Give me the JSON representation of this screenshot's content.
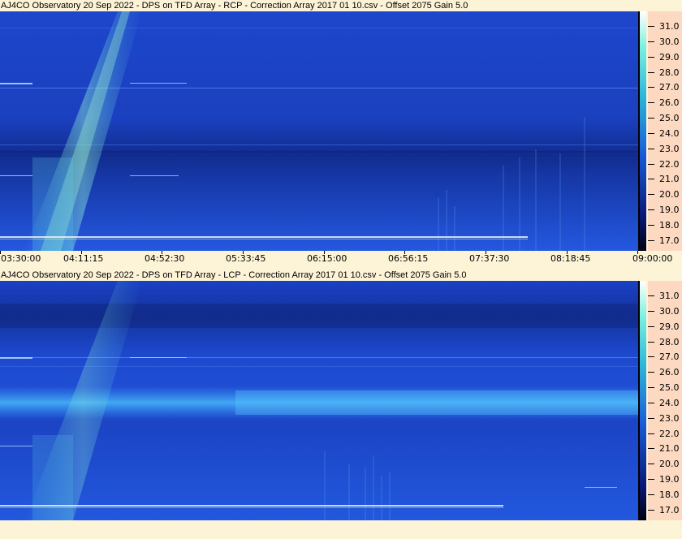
{
  "panels": [
    {
      "title": "AJ4CO Observatory 20 Sep 2022  -  DPS on TFD Array  -  RCP  -  Correction Array 2017 01 10.csv  -  Offset 2075  Gain 5.0",
      "freq_labels": [
        "31.0",
        "30.0",
        "29.0",
        "28.0",
        "27.0",
        "26.0",
        "25.0",
        "24.0",
        "23.0",
        "22.0",
        "21.0",
        "20.0",
        "19.0",
        "18.0",
        "17.0"
      ]
    },
    {
      "title": "AJ4CO Observatory 20 Sep 2022  -  DPS on TFD Array  -  LCP  -  Correction Array 2017 01 10.csv  -  Offset 2075  Gain 5.0",
      "freq_labels": [
        "31.0",
        "30.0",
        "29.0",
        "28.0",
        "27.0",
        "26.0",
        "25.0",
        "24.0",
        "23.0",
        "22.0",
        "21.0",
        "20.0",
        "19.0",
        "18.0",
        "17.0"
      ]
    }
  ],
  "time_labels": [
    "03:30:00",
    "04:11:15",
    "04:52:30",
    "05:33:45",
    "06:15:00",
    "06:56:15",
    "07:37:30",
    "08:18:45",
    "09:00:00"
  ],
  "colors": {
    "background": "#fdf3d6",
    "scale_bg": "#fcd9c0",
    "burst": "#7cf0e0",
    "rcp_dark_band": "#102a88",
    "lcp_bright_band": "#3aa0f0"
  }
}
